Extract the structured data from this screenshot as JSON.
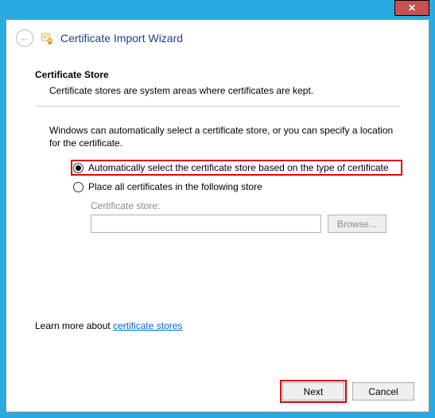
{
  "titlebar": {
    "close_glyph": "✕"
  },
  "header": {
    "back_glyph": "←",
    "title": "Certificate Import Wizard"
  },
  "section": {
    "title": "Certificate Store",
    "desc": "Certificate stores are system areas where certificates are kept."
  },
  "body": {
    "instruction": "Windows can automatically select a certificate store, or you can specify a location for the certificate.",
    "radio_auto": "Automatically select the certificate store based on the type of certificate",
    "radio_manual": "Place all certificates in the following store",
    "store_label": "Certificate store:",
    "store_value": "",
    "browse_label": "Browse...",
    "selected": "auto"
  },
  "learn": {
    "prefix": "Learn more about ",
    "link": "certificate stores"
  },
  "footer": {
    "next": "Next",
    "cancel": "Cancel"
  }
}
